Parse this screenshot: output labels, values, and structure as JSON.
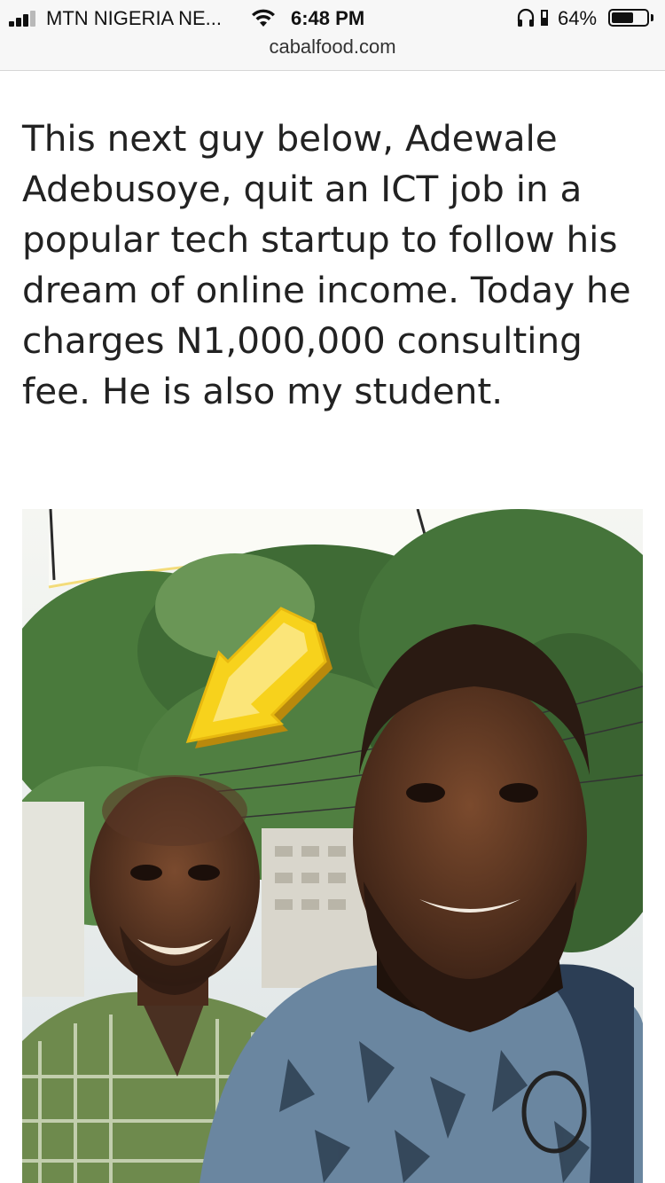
{
  "status_bar": {
    "carrier": "MTN NIGERIA NE...",
    "time": "6:48 PM",
    "battery_percent": "64%",
    "battery_level": 0.64,
    "signal_bars_filled": 3,
    "signal_bars_total": 4,
    "icons": [
      "signal-bars-icon",
      "wifi-icon",
      "headphones-icon",
      "rotation-lock-icon",
      "battery-icon"
    ]
  },
  "browser": {
    "url": "cabalfood.com"
  },
  "article": {
    "paragraph": "This next guy below, Adewale Adebusoye, quit an ICT job in a popular tech startup to follow his dream of online income. Today he charges N1,000,000 consulting fee. He is also my student."
  },
  "photo": {
    "annotation": "yellow-arrow-icon",
    "colors": {
      "arrow": "#f7d21c",
      "foliage": "#3f6b35",
      "sky": "#e9eef0"
    }
  }
}
